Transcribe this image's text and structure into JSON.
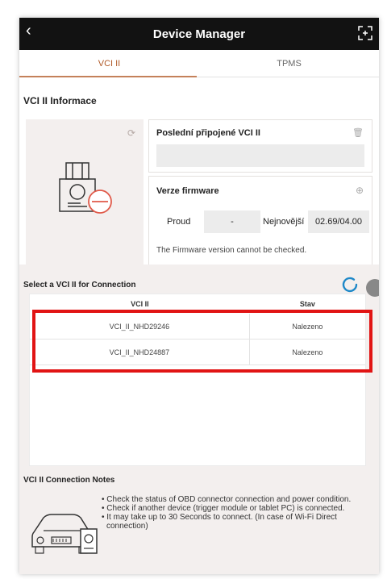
{
  "header": {
    "title": "Device Manager",
    "back_icon": "back-arrow-icon",
    "expand_icon": "fullscreen-icon"
  },
  "tabs": [
    {
      "label": "VCI II",
      "active": true
    },
    {
      "label": "TPMS",
      "active": false
    }
  ],
  "info": {
    "section_title": "VCI II Informace",
    "last_connected_label": "Poslední připojené VCI II",
    "last_connected_value": "",
    "firmware_label": "Verze firmware",
    "current_label": "Proud",
    "current_value": "-",
    "latest_label": "Nejnovější",
    "latest_value": "02.69/04.00",
    "firmware_message": "The Firmware version cannot be checked."
  },
  "connection": {
    "title": "Select a VCI II for Connection",
    "columns": [
      "VCI II",
      "Stav"
    ],
    "rows": [
      {
        "name": "VCI_II_NHD29246",
        "status": "Nalezeno"
      },
      {
        "name": "VCI_II_NHD24887",
        "status": "Nalezeno"
      }
    ]
  },
  "notes": {
    "title": "VCI II Connection Notes",
    "items": [
      "• Check the status of OBD connector connection and power condition.",
      "• Check if another device (trigger module or tablet PC) is connected.",
      "• It may take up to 30 Seconds to connect. (In case of Wi-Fi Direct connection)"
    ]
  },
  "colors": {
    "header_bg": "#121212",
    "accent": "#b05a28",
    "panel_bg": "#f3efee",
    "highlight": "#e11414",
    "spinner": "#1e88c8"
  }
}
